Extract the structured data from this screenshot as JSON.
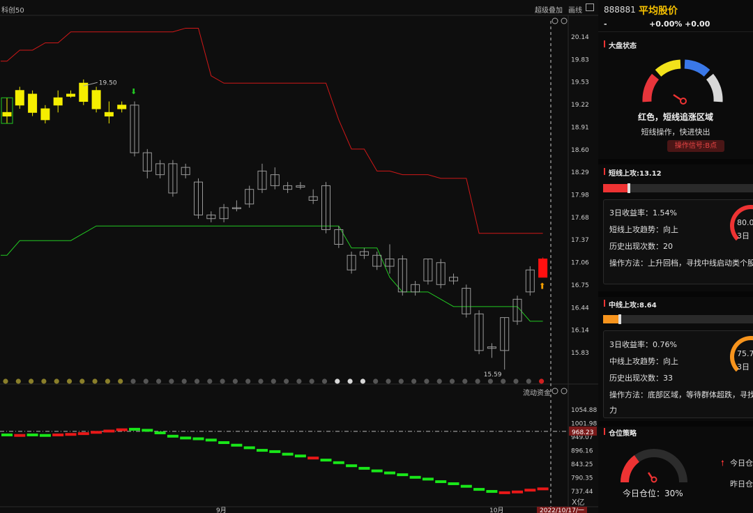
{
  "chart": {
    "index_name": "科创50",
    "toolbar": {
      "overlay": "超级叠加",
      "draw": "画线"
    },
    "price_axis": [
      "20.14",
      "19.83",
      "19.53",
      "19.22",
      "18.91",
      "18.60",
      "18.29",
      "17.98",
      "17.68",
      "17.37",
      "17.06",
      "16.75",
      "16.44",
      "16.14",
      "15.83"
    ],
    "high_label": "19.50",
    "low_label": "15.59",
    "volume_title": "流动资金",
    "volume_axis": [
      "1054.88",
      "1001.98",
      "949.07",
      "896.16",
      "843.25",
      "790.35",
      "737.44"
    ],
    "volume_current": "968.23",
    "volume_unit": "X亿",
    "month_labels": [
      "9月",
      "10月"
    ],
    "cursor_date": "2022/10/17/一"
  },
  "chart_data": {
    "type": "candlestick",
    "price_ylim": [
      15.6,
      20.3
    ],
    "candles": [
      {
        "o": 19.05,
        "h": 19.3,
        "l": 18.95,
        "c": 19.1,
        "color": "yellow"
      },
      {
        "o": 19.2,
        "h": 19.45,
        "l": 19.15,
        "c": 19.4,
        "color": "yellow"
      },
      {
        "o": 19.35,
        "h": 19.4,
        "l": 19.05,
        "c": 19.1,
        "color": "yellow"
      },
      {
        "o": 19.15,
        "h": 19.2,
        "l": 18.95,
        "c": 19.0,
        "color": "yellow"
      },
      {
        "o": 19.2,
        "h": 19.4,
        "l": 19.1,
        "c": 19.3,
        "color": "yellow"
      },
      {
        "o": 19.35,
        "h": 19.4,
        "l": 19.3,
        "c": 19.32,
        "color": "yellow"
      },
      {
        "o": 19.5,
        "h": 19.55,
        "l": 19.2,
        "c": 19.25,
        "color": "yellow"
      },
      {
        "o": 19.4,
        "h": 19.45,
        "l": 19.1,
        "c": 19.15,
        "color": "yellow"
      },
      {
        "o": 19.1,
        "h": 19.25,
        "l": 18.95,
        "c": 19.05,
        "color": "yellow"
      },
      {
        "o": 19.15,
        "h": 19.25,
        "l": 19.1,
        "c": 19.2,
        "color": "yellow"
      },
      {
        "o": 18.55,
        "h": 19.25,
        "l": 18.5,
        "c": 19.2,
        "color": "hollow"
      },
      {
        "o": 18.55,
        "h": 18.6,
        "l": 18.2,
        "c": 18.3,
        "color": "hollow"
      },
      {
        "o": 18.4,
        "h": 18.45,
        "l": 18.2,
        "c": 18.25,
        "color": "hollow"
      },
      {
        "o": 18.4,
        "h": 18.45,
        "l": 17.95,
        "c": 18.0,
        "color": "hollow"
      },
      {
        "o": 18.35,
        "h": 18.4,
        "l": 18.2,
        "c": 18.25,
        "color": "hollow"
      },
      {
        "o": 18.15,
        "h": 18.2,
        "l": 17.65,
        "c": 17.7,
        "color": "hollow"
      },
      {
        "o": 17.7,
        "h": 17.75,
        "l": 17.6,
        "c": 17.65,
        "color": "hollow"
      },
      {
        "o": 17.8,
        "h": 17.85,
        "l": 17.6,
        "c": 17.65,
        "color": "hollow"
      },
      {
        "o": 17.8,
        "h": 17.9,
        "l": 17.75,
        "c": 17.8,
        "color": "hollow"
      },
      {
        "o": 18.05,
        "h": 18.1,
        "l": 17.8,
        "c": 17.85,
        "color": "hollow"
      },
      {
        "o": 18.3,
        "h": 18.4,
        "l": 18.0,
        "c": 18.05,
        "color": "hollow"
      },
      {
        "o": 18.25,
        "h": 18.35,
        "l": 18.05,
        "c": 18.1,
        "color": "hollow"
      },
      {
        "o": 18.1,
        "h": 18.15,
        "l": 18.0,
        "c": 18.05,
        "color": "hollow"
      },
      {
        "o": 18.1,
        "h": 18.15,
        "l": 18.05,
        "c": 18.08,
        "color": "hollow"
      },
      {
        "o": 17.95,
        "h": 18.05,
        "l": 17.85,
        "c": 17.9,
        "color": "hollow"
      },
      {
        "o": 18.1,
        "h": 18.15,
        "l": 17.45,
        "c": 17.5,
        "color": "hollow"
      },
      {
        "o": 17.5,
        "h": 17.55,
        "l": 17.25,
        "c": 17.3,
        "color": "hollow"
      },
      {
        "o": 17.15,
        "h": 17.2,
        "l": 16.9,
        "c": 16.95,
        "color": "hollow"
      },
      {
        "o": 17.2,
        "h": 17.25,
        "l": 17.1,
        "c": 17.15,
        "color": "hollow"
      },
      {
        "o": 17.15,
        "h": 17.2,
        "l": 16.95,
        "c": 17.0,
        "color": "hollow"
      },
      {
        "o": 17.1,
        "h": 17.3,
        "l": 16.9,
        "c": 17.0,
        "color": "hollow"
      },
      {
        "o": 17.1,
        "h": 17.15,
        "l": 16.6,
        "c": 16.65,
        "color": "hollow"
      },
      {
        "o": 16.75,
        "h": 16.8,
        "l": 16.6,
        "c": 16.65,
        "color": "hollow"
      },
      {
        "o": 17.1,
        "h": 17.1,
        "l": 16.75,
        "c": 16.8,
        "color": "hollow"
      },
      {
        "o": 17.05,
        "h": 17.1,
        "l": 16.7,
        "c": 16.75,
        "color": "hollow"
      },
      {
        "o": 16.85,
        "h": 16.9,
        "l": 16.75,
        "c": 16.8,
        "color": "hollow"
      },
      {
        "o": 16.7,
        "h": 16.75,
        "l": 16.3,
        "c": 16.35,
        "color": "hollow"
      },
      {
        "o": 16.35,
        "h": 16.4,
        "l": 15.8,
        "c": 15.85,
        "color": "hollow"
      },
      {
        "o": 15.9,
        "h": 15.95,
        "l": 15.75,
        "c": 15.88,
        "color": "hollow"
      },
      {
        "o": 16.3,
        "h": 16.3,
        "l": 15.59,
        "c": 15.85,
        "color": "hollow"
      },
      {
        "o": 16.55,
        "h": 16.6,
        "l": 16.2,
        "c": 16.25,
        "color": "hollow"
      },
      {
        "o": 16.95,
        "h": 17.0,
        "l": 16.6,
        "c": 16.65,
        "color": "hollow"
      },
      {
        "o": 16.85,
        "h": 17.12,
        "l": 16.85,
        "c": 17.1,
        "color": "red"
      }
    ],
    "upper_band": [
      19.8,
      19.95,
      19.95,
      20.05,
      20.05,
      20.2,
      20.2,
      20.2,
      20.2,
      20.2,
      20.2,
      20.2,
      20.2,
      20.2,
      20.25,
      20.25,
      19.6,
      19.5,
      19.5,
      19.5,
      19.5,
      19.5,
      19.5,
      19.5,
      19.5,
      19.5,
      19.0,
      18.6,
      18.6,
      18.3,
      18.3,
      18.25,
      18.25,
      18.25,
      18.2,
      18.2,
      18.2,
      17.45,
      17.45,
      17.45,
      17.45,
      17.45,
      17.45
    ],
    "lower_band": [
      17.15,
      17.35,
      17.35,
      17.35,
      17.35,
      17.35,
      17.45,
      17.55,
      17.55,
      17.55,
      17.55,
      17.55,
      17.55,
      17.55,
      17.55,
      17.55,
      17.55,
      17.55,
      17.55,
      17.55,
      17.55,
      17.55,
      17.55,
      17.55,
      17.55,
      17.55,
      17.55,
      17.25,
      17.25,
      17.25,
      16.85,
      16.65,
      16.65,
      16.65,
      16.55,
      16.45,
      16.45,
      16.45,
      16.45,
      16.45,
      16.45,
      16.25,
      16.25
    ],
    "volume_ylim": [
      715,
      1080
    ],
    "flow_values": [
      960,
      958,
      960,
      958,
      960,
      962,
      965,
      970,
      975,
      980,
      982,
      978,
      968,
      955,
      948,
      945,
      940,
      930,
      920,
      910,
      900,
      895,
      885,
      878,
      870,
      862,
      852,
      840,
      830,
      820,
      812,
      805,
      795,
      788,
      778,
      770,
      760,
      748,
      740,
      735,
      738,
      745,
      750
    ],
    "flow_colors": [
      "green",
      "red",
      "green",
      "green",
      "red",
      "red",
      "red",
      "red",
      "red",
      "red",
      "green",
      "green",
      "green",
      "green",
      "green",
      "green",
      "green",
      "green",
      "green",
      "green",
      "green",
      "green",
      "green",
      "green",
      "red",
      "green",
      "green",
      "green",
      "green",
      "green",
      "green",
      "green",
      "green",
      "green",
      "green",
      "green",
      "green",
      "green",
      "green",
      "red",
      "red",
      "red",
      "red"
    ],
    "dot_colors": [
      "olive",
      "olive",
      "olive",
      "olive",
      "olive",
      "olive",
      "olive",
      "olive",
      "olive",
      "olive",
      "gray",
      "gray",
      "gray",
      "gray",
      "gray",
      "gray",
      "gray",
      "gray",
      "gray",
      "gray",
      "gray",
      "gray",
      "gray",
      "gray",
      "gray",
      "gray",
      "white",
      "white",
      "white",
      "gray",
      "gray",
      "gray",
      "gray",
      "gray",
      "gray",
      "gray",
      "gray",
      "gray",
      "gray",
      "gray",
      "gray",
      "gray",
      "red"
    ]
  },
  "panel": {
    "code": "888881",
    "name": "平均股价",
    "price": "-",
    "pct": "+0.00%",
    "change": "+0.00",
    "market": {
      "title": "大盘状态",
      "status": "红色，短线追涨区域",
      "desc": "短线操作，快进快出",
      "signal": "操作信号:B点",
      "gauge_value": 0.15
    },
    "short": {
      "title": "短线上攻:13.12",
      "bar_color": "#e33",
      "bar_fill": 0.18,
      "lines": [
        "3日收益率：1.54%",
        "短线上攻趋势：向上",
        "历史出现次数：20",
        "操作方法：上升回档，寻找中线启动类个股"
      ],
      "ring_value": "80.0",
      "ring_sub": "3日",
      "ring_color": "#e33"
    },
    "mid": {
      "title": "中线上攻:8.64",
      "bar_color": "#f7941d",
      "bar_fill": 0.12,
      "lines": [
        "3日收益率：0.76%",
        "中线上攻趋势：向上",
        "历史出现次数：33",
        "操作方法：底部区域，等待群体超跌，寻找",
        "力"
      ],
      "ring_value": "75.7",
      "ring_sub": "3日",
      "ring_color": "#f7941d"
    },
    "position": {
      "title": "仓位策略",
      "today": "今日仓位：30%",
      "up_label": "今日仓",
      "yesterday_label": "昨日仓",
      "level": 0.3
    }
  }
}
